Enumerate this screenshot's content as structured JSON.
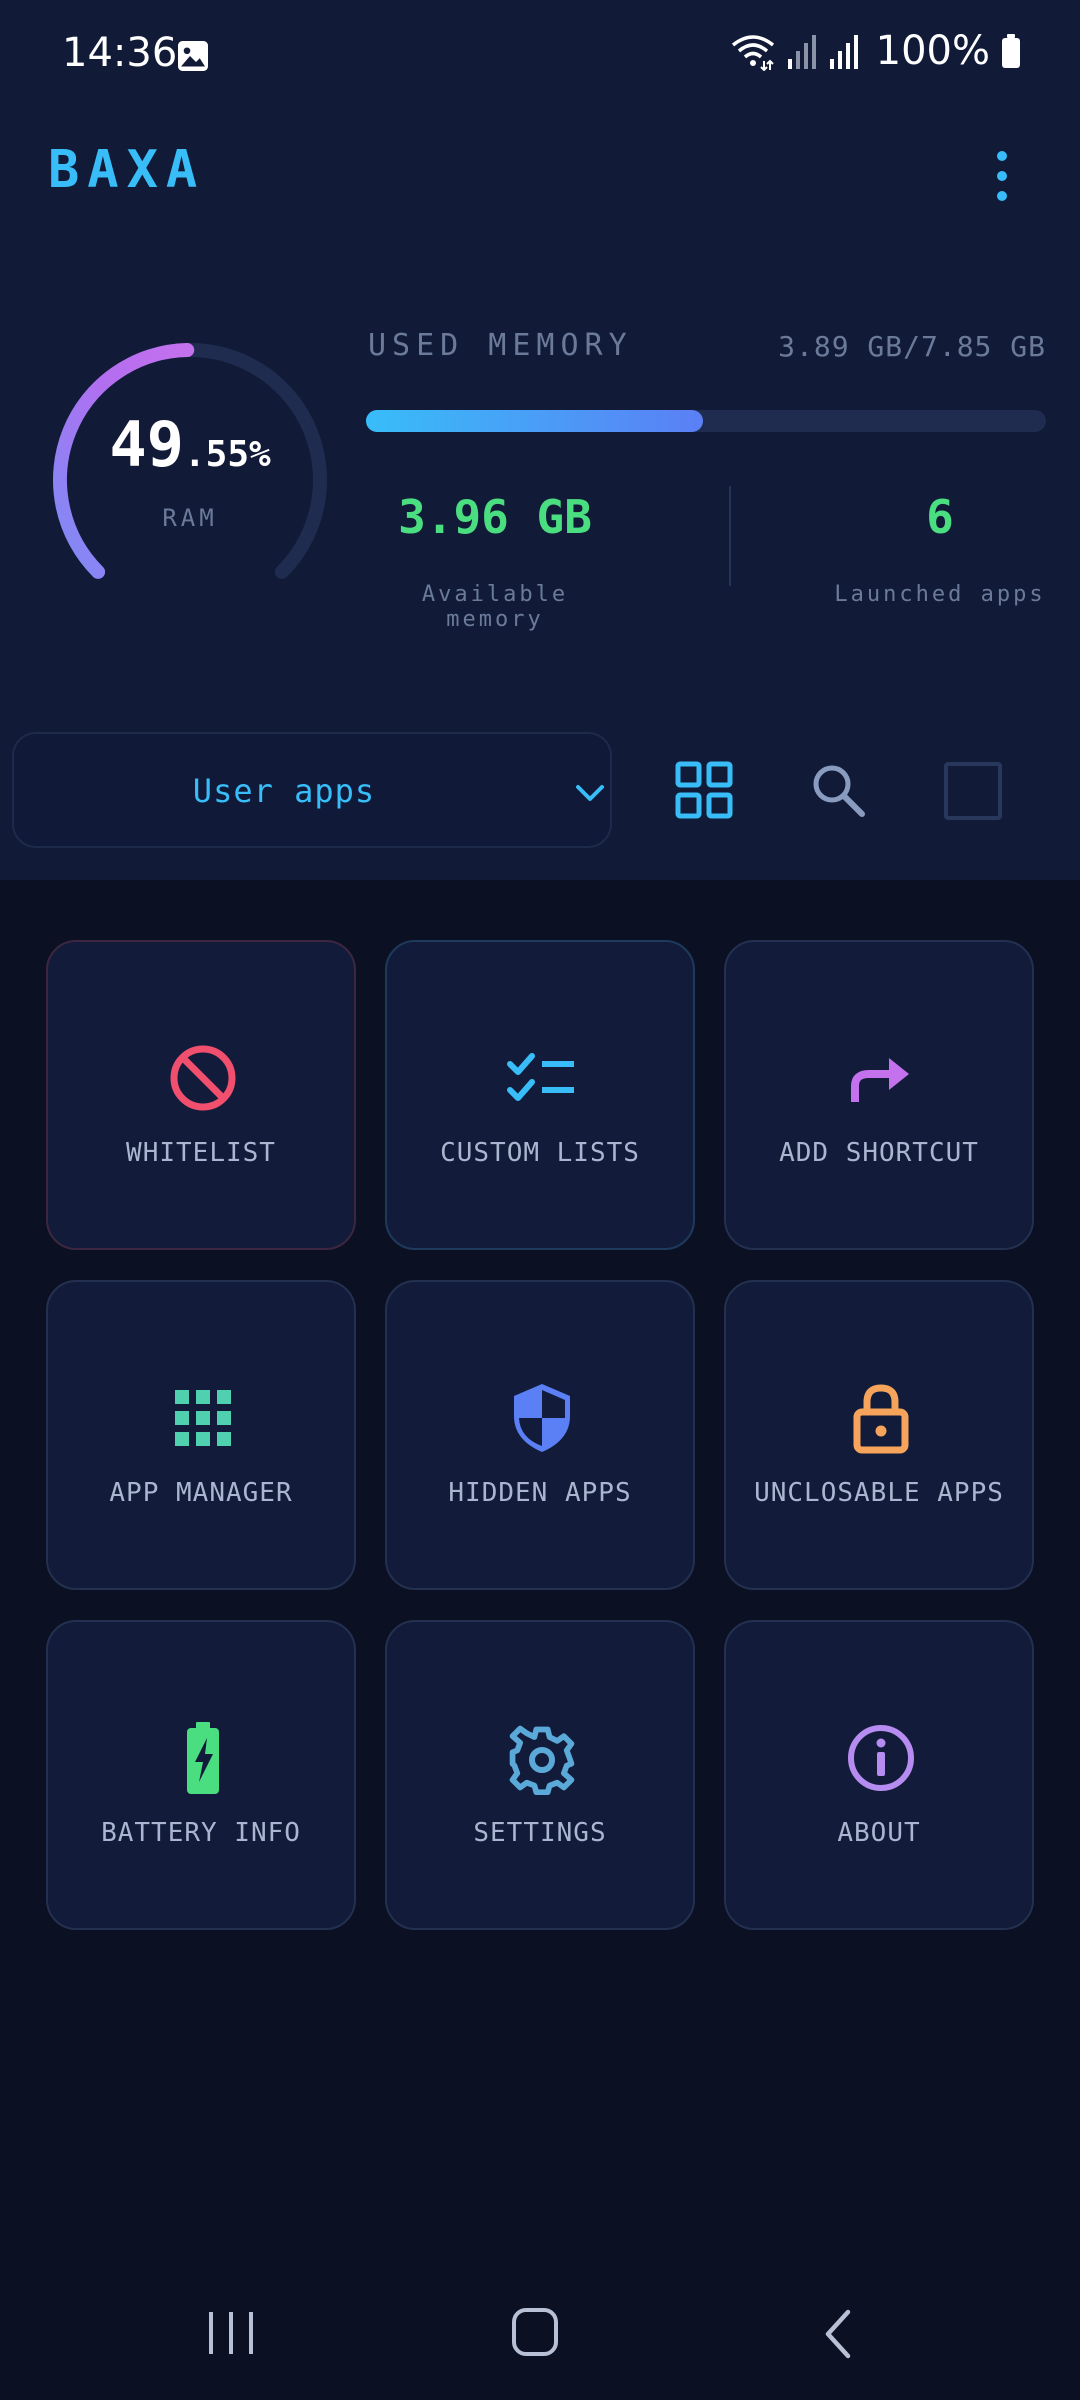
{
  "status_bar": {
    "time": "14:36",
    "battery_percent": "100%",
    "icons": [
      "gallery-icon",
      "wifi-icon",
      "signal-icon",
      "signal-icon",
      "battery-icon"
    ]
  },
  "app_bar": {
    "title": "BAXA",
    "menu_icon": "more-vert-icon"
  },
  "ram": {
    "percent_int": "49",
    "percent_frac": ".55%",
    "percent_value": 49.55,
    "label": "RAM"
  },
  "memory": {
    "title": "USED MEMORY",
    "amount": "3.89 GB/7.85 GB",
    "used_fraction": 0.4955,
    "available_value": "3.96 GB",
    "available_label": "Available memory",
    "launched_value": "6",
    "launched_label": "Launched apps"
  },
  "filter": {
    "selected": "User apps",
    "icons": [
      "grid-view-icon",
      "search-icon",
      "checkbox-icon"
    ]
  },
  "tiles": [
    {
      "label": "WHITELIST",
      "icon": "block-icon",
      "color": "#f0506e"
    },
    {
      "label": "CUSTOM LISTS",
      "icon": "checklist-icon",
      "color": "#38bdf8"
    },
    {
      "label": "ADD SHORTCUT",
      "icon": "redo-arrow-icon",
      "color": "#c471ed"
    },
    {
      "label": "APP MANAGER",
      "icon": "apps-grid-icon",
      "color": "#4fd1b0"
    },
    {
      "label": "HIDDEN APPS",
      "icon": "shield-icon",
      "color": "#5b7ff5"
    },
    {
      "label": "UNCLOSABLE APPS",
      "icon": "lock-icon",
      "color": "#f6a35b"
    },
    {
      "label": "BATTERY INFO",
      "icon": "battery-charging-icon",
      "color": "#4ade80"
    },
    {
      "label": "SETTINGS",
      "icon": "gear-icon",
      "color": "#5aa9d8"
    },
    {
      "label": "ABOUT",
      "icon": "info-icon",
      "color": "#b68cf0"
    }
  ],
  "colors": {
    "accent": "#38bdf8",
    "green": "#4ade80",
    "background": "#0b1023",
    "panel": "#111b38"
  }
}
